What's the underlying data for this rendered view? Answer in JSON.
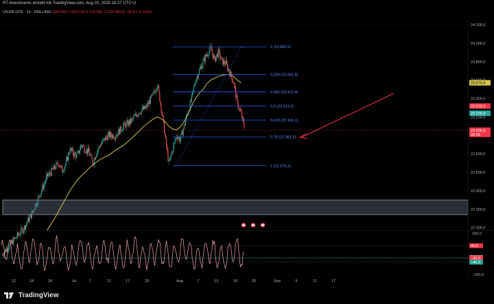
{
  "caption": "RT-Investments erstellt mit TradingView.com, Aug 20, 2025 16:27 UTC+2",
  "symbol_line": {
    "prefix": "US100 CFD · 1h · SKILLING",
    "ohlc": "O23.092,1 H23.132,1 L22.981,1 C23.055,8 −35,8 (−0,16%)"
  },
  "logo_text": "TradingView",
  "colors": {
    "background": "#000000",
    "candle_up": "#26a69a",
    "candle_down": "#ef5350",
    "ma": "#d4c24a",
    "fib": "#2962ff",
    "arrow": "#f23645",
    "rsi": "#f7a8ad",
    "label_red": "#f23645",
    "label_green": "#26a69a",
    "label_yellow": "#d4c24a"
  },
  "chart_data": {
    "type": "candlestick",
    "x_ticks": [
      "12",
      "18",
      "24",
      "Jul",
      "7",
      "11",
      "17",
      "23",
      "Aug",
      "7",
      "13",
      "19",
      "25",
      "Sep",
      "5",
      "11",
      "17"
    ],
    "y_ticks": [
      "24.200,0",
      "24.000,0",
      "23.800,0",
      "23.600,0",
      "23.400,0",
      "23.200,0",
      "23.000,0",
      "22.800,0",
      "22.600,0",
      "22.400,0",
      "22.200,0",
      "22.000,0"
    ],
    "ylim": [
      21990,
      24260
    ],
    "price_series": [
      [
        0,
        21700
      ],
      [
        3,
        21850
      ],
      [
        6,
        22000
      ],
      [
        8,
        22150
      ],
      [
        10,
        22350
      ],
      [
        12,
        22550
      ],
      [
        14,
        22650
      ],
      [
        15,
        22700
      ],
      [
        16,
        22620
      ],
      [
        17,
        22700
      ],
      [
        18,
        22850
      ],
      [
        19,
        22800
      ],
      [
        20,
        22780
      ],
      [
        21,
        22900
      ],
      [
        22,
        22850
      ],
      [
        23,
        22820
      ],
      [
        24,
        22700
      ],
      [
        25,
        22820
      ],
      [
        26,
        22900
      ],
      [
        28,
        23000
      ],
      [
        30,
        23000
      ],
      [
        32,
        23100
      ],
      [
        34,
        23150
      ],
      [
        36,
        23250
      ],
      [
        38,
        23300
      ],
      [
        40,
        23450
      ],
      [
        41,
        23560
      ],
      [
        42,
        23300
      ],
      [
        43,
        23000
      ],
      [
        44,
        22690
      ],
      [
        45,
        22850
      ],
      [
        46,
        23000
      ],
      [
        47,
        22950
      ],
      [
        48,
        23100
      ],
      [
        49,
        23250
      ],
      [
        50,
        23400
      ],
      [
        51,
        23600
      ],
      [
        52,
        23700
      ],
      [
        53,
        23800
      ],
      [
        54,
        23880
      ],
      [
        55,
        23940
      ],
      [
        56,
        23820
      ],
      [
        57,
        23900
      ],
      [
        58,
        23800
      ],
      [
        59,
        23780
      ],
      [
        60,
        23680
      ],
      [
        61,
        23580
      ],
      [
        62,
        23350
      ],
      [
        63,
        23230
      ],
      [
        64,
        23060
      ]
    ],
    "ma_series": [
      [
        12,
        21970
      ],
      [
        14,
        22100
      ],
      [
        16,
        22250
      ],
      [
        18,
        22400
      ],
      [
        20,
        22520
      ],
      [
        22,
        22600
      ],
      [
        24,
        22680
      ],
      [
        26,
        22740
      ],
      [
        28,
        22780
      ],
      [
        30,
        22840
      ],
      [
        32,
        22890
      ],
      [
        34,
        22960
      ],
      [
        36,
        23040
      ],
      [
        38,
        23120
      ],
      [
        40,
        23180
      ],
      [
        41,
        23200
      ],
      [
        42,
        23180
      ],
      [
        43,
        23150
      ],
      [
        44,
        23100
      ],
      [
        45,
        23070
      ],
      [
        46,
        23060
      ],
      [
        47,
        23090
      ],
      [
        48,
        23150
      ],
      [
        49,
        23230
      ],
      [
        50,
        23320
      ],
      [
        51,
        23400
      ],
      [
        52,
        23460
      ],
      [
        53,
        23500
      ],
      [
        54,
        23560
      ],
      [
        55,
        23600
      ],
      [
        56,
        23620
      ],
      [
        57,
        23640
      ],
      [
        58,
        23650
      ],
      [
        59,
        23660
      ],
      [
        60,
        23660
      ],
      [
        61,
        23640
      ],
      [
        62,
        23600
      ],
      [
        63,
        23570
      ]
    ],
    "fib_levels": [
      {
        "label": "0 (23.960,5)",
        "value": 23960.5
      },
      {
        "label": "0,236 (23.661,8)",
        "value": 23661.8
      },
      {
        "label": "0,382 (23.472,4)",
        "value": 23472.4
      },
      {
        "label": "0,5 (23.319,2)",
        "value": 23319.2
      },
      {
        "label": "0,618 (23.166,1)",
        "value": 23166.1
      },
      {
        "label": "0,76 (22.981,8)",
        "value": 22981.8
      },
      {
        "label": "1 (22.670,3)",
        "value": 22670.3
      }
    ],
    "support_zone": [
      22140,
      22300
    ],
    "price_labels": [
      {
        "text": "23.570,4",
        "value": 23570.4,
        "color": "yellow"
      },
      {
        "text": "23.318,3",
        "value": 23318.3,
        "color": "red"
      },
      {
        "text": "23.239,9",
        "value": 23239.9,
        "color": "green"
      },
      {
        "text": "23.055,8",
        "value": 23055.8,
        "color": "red",
        "sub": "32:59"
      }
    ],
    "rsi": {
      "ylim": [
        -100,
        100
      ],
      "y_ticks": [
        "100,0",
        "−100,0"
      ],
      "levels": [
        40,
        -40
      ],
      "labels": [
        {
          "text": "40,0",
          "value": 40,
          "color": "red"
        },
        {
          "text": "−17,8",
          "value": -17.8,
          "color": "white"
        },
        {
          "text": "−20,0",
          "value": -20,
          "color": "red"
        },
        {
          "text": "−40,0",
          "value": -40,
          "color": "green"
        }
      ]
    }
  }
}
